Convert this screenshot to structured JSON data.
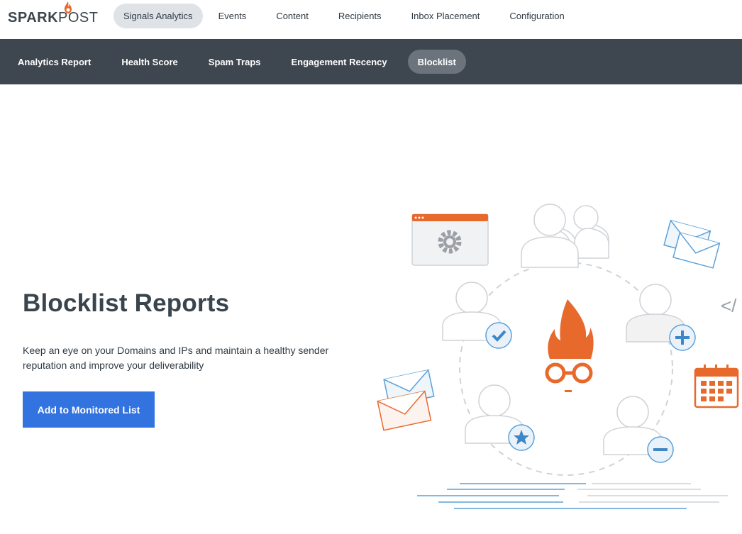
{
  "brand": {
    "name_part1": "SPARK",
    "name_part2": "POST",
    "accent": "#e8692c"
  },
  "top_nav": {
    "items": [
      {
        "label": "Signals Analytics",
        "active": true
      },
      {
        "label": "Events",
        "active": false
      },
      {
        "label": "Content",
        "active": false
      },
      {
        "label": "Recipients",
        "active": false
      },
      {
        "label": "Inbox Placement",
        "active": false
      },
      {
        "label": "Configuration",
        "active": false
      }
    ]
  },
  "sub_nav": {
    "items": [
      {
        "label": "Analytics Report",
        "active": false
      },
      {
        "label": "Health Score",
        "active": false
      },
      {
        "label": "Spam Traps",
        "active": false
      },
      {
        "label": "Engagement Recency",
        "active": false
      },
      {
        "label": "Blocklist",
        "active": true
      }
    ]
  },
  "main": {
    "title": "Blocklist Reports",
    "description": "Keep an eye on your Domains and IPs and maintain a healthy sender reputation and improve your deliverability",
    "cta_label": "Add to Monitored List"
  },
  "illustration": {
    "code_glyph": "</",
    "icons": [
      "settings-window-icon",
      "user-group-icon",
      "envelopes-icon",
      "user-check-icon",
      "user-add-icon",
      "sparkpost-mascot-icon",
      "calendar-icon",
      "user-star-icon",
      "user-remove-icon",
      "code-icon"
    ]
  },
  "colors": {
    "primary_button": "#3273e0",
    "subnav_bg": "#3e4750",
    "active_top": "#dfe3e8",
    "orange": "#e8692c",
    "blue_icon": "#5aa0d8"
  }
}
